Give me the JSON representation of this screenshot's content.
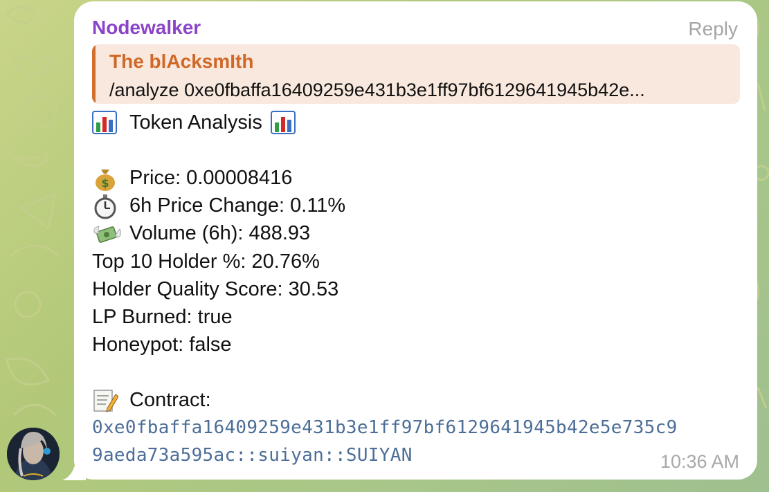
{
  "message": {
    "sender": "Nodewalker",
    "reply_label": "Reply",
    "quote": {
      "author": "The blAcksmIth",
      "text": "/analyze 0xe0fbaffa16409259e431b3e1ff97bf6129641945b42e..."
    },
    "title": "Token Analysis",
    "lines": [
      {
        "icon": "money-bag-icon",
        "text": "Price: 0.00008416"
      },
      {
        "icon": "stopwatch-icon",
        "text": "6h Price Change: 0.11%"
      },
      {
        "icon": "money-wings-icon",
        "text": "Volume (6h): 488.93"
      },
      {
        "text": "Top 10 Holder %: 20.76%"
      },
      {
        "text": "Holder Quality Score: 30.53"
      },
      {
        "text": "LP Burned: true"
      },
      {
        "text": "Honeypot: false"
      }
    ],
    "contract_label": "Contract:",
    "contract_line1": "0xe0fbaffa16409259e431b3e1ff97bf6129641945b42e5e735c9",
    "contract_line2": "9aeda73a595ac::suiyan::SUIYAN",
    "time": "10:36 AM"
  },
  "colors": {
    "sender": "#8b44c9",
    "quote_accent": "#d26f2c",
    "quote_bg": "#f8e8dd",
    "contract": "#4c6e98"
  }
}
